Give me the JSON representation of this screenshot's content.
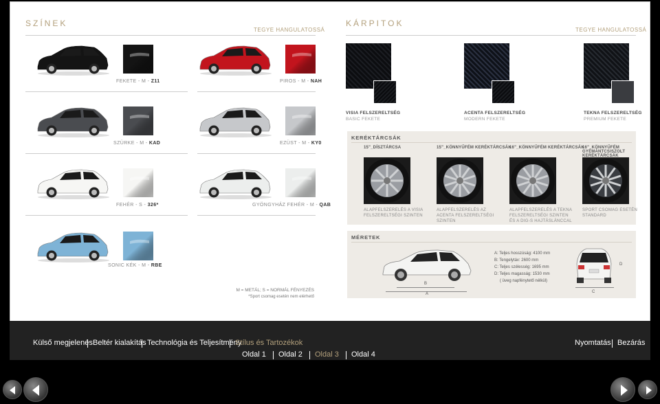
{
  "colors": {
    "heading": "SZÍNEK",
    "tagline": "TEGYE HANGULATOSSÁ",
    "items": [
      {
        "label": "FEKETE - M - ",
        "code": "Z11",
        "paint": "#141414"
      },
      {
        "label": "PIROS - M - ",
        "code": "NAH",
        "paint": "#c2141d"
      },
      {
        "label": "SZÜRKE - M - ",
        "code": "KAD",
        "paint": "#4a4c50"
      },
      {
        "label": "EZÜST - M - ",
        "code": "KY0",
        "paint": "#c6c8cb"
      },
      {
        "label": "FEHÉR - S - ",
        "code": "326*",
        "paint": "#f6f6f4"
      },
      {
        "label": "GYÖNGYHÁZ FEHÉR - M - ",
        "code": "QAB",
        "paint": "#eceeed"
      },
      {
        "label": "SONIC KÉK - M - ",
        "code": "RBE",
        "paint": "#7eb3d6"
      }
    ],
    "note_line1": "M = METÁL; S = NORMÁL FÉNYEZÉS",
    "note_line2": "*Sport csomag esetén nem elérhető"
  },
  "upholstery": {
    "heading": "KÁRPITOK",
    "tagline": "TEGYE HANGULATOSSÁ",
    "items": [
      {
        "title": "VISIA FELSZERELTSÉG",
        "subtitle": "BASIC FEKETE"
      },
      {
        "title": "ACENTA FELSZERELTSÉG",
        "subtitle": "MODERN FEKETE"
      },
      {
        "title": "TEKNA FELSZERELTSÉG",
        "subtitle": "PREMIUM FEKETE"
      }
    ]
  },
  "wheels": {
    "title": "KERÉKTÁRCSÁK",
    "items": [
      {
        "title": "15\"_DÍSZTÁRCSA",
        "desc": "ALAPFELSZERELÉS A VISIA FELSZERELTSÉGI SZINTEN"
      },
      {
        "title": "15\"_KÖNNYŰFÉM KERÉKTÁRCSÁK",
        "desc": "ALAPFELSZERELÉS AZ ACENTA FELSZERELTSÉGI SZINTEN"
      },
      {
        "title": "16\"_KÖNNYŰFÉM KERÉKTÁRCSÁK",
        "desc": "ALAPFELSZERELÉS A TEKNA FELSZERELTSÉGI SZINTEN ÉS A DIG-S HAJTÁSLÁNCCAL"
      },
      {
        "title": "16\"_KÖNNYŰFÉM GYÉMÁNTCSISZOLT KERÉKTÁRCSÁK",
        "desc": "SPORT CSOMAG ESETÉN STANDARD"
      }
    ]
  },
  "dimensions": {
    "title": "MÉRETEK",
    "specs": [
      "A: Teljes hosszúság: 4100 mm",
      "B: Tengelytáv: 2600 mm",
      "C: Teljes szélesség: 1695 mm",
      "D: Teljes magasság: 1530 mm",
      "( üveg napfénytető nélkül)"
    ],
    "label_a": "A",
    "label_b": "B",
    "label_c": "C",
    "label_d": "D"
  },
  "nav": {
    "sections": [
      "Külső megjelenés",
      "Beltér kialakítás",
      "Technológia és Teljesítmény",
      "Stílus és Tartozékok"
    ],
    "selected_section": 3,
    "right": [
      "Nyomtatás",
      "Bezárás"
    ],
    "pages": [
      "Oldal 1",
      "Oldal 2",
      "Oldal 3",
      "Oldal 4"
    ],
    "selected_page": 2
  }
}
